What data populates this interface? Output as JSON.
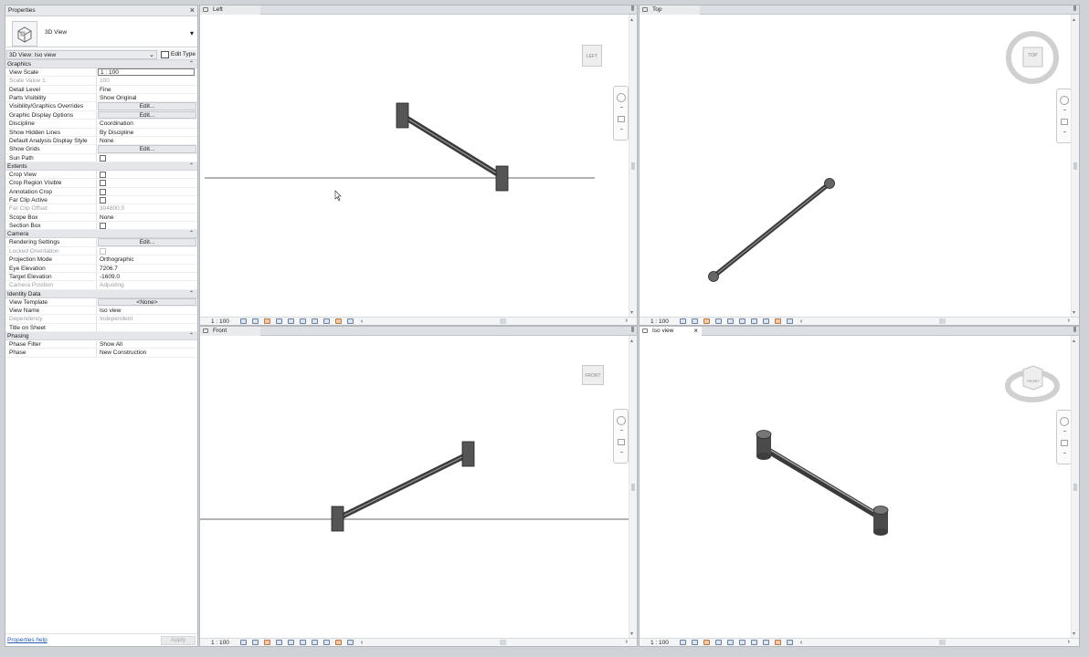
{
  "properties": {
    "title": "Properties",
    "type_name": "3D View",
    "instance_selector": "3D View: Iso view",
    "edit_type": "Edit Type",
    "sections": [
      {
        "name": "Graphics",
        "rows": [
          {
            "k": "View Scale",
            "v": "1 : 100",
            "kind": "select"
          },
          {
            "k": "Scale Value    1:",
            "v": "100",
            "dim": true
          },
          {
            "k": "Detail Level",
            "v": "Fine"
          },
          {
            "k": "Parts Visibility",
            "v": "Show Original"
          },
          {
            "k": "Visibility/Graphics Overrides",
            "v": "Edit...",
            "kind": "button"
          },
          {
            "k": "Graphic Display Options",
            "v": "Edit...",
            "kind": "button"
          },
          {
            "k": "Discipline",
            "v": "Coordination"
          },
          {
            "k": "Show Hidden Lines",
            "v": "By Discipline"
          },
          {
            "k": "Default Analysis Display Style",
            "v": "None"
          },
          {
            "k": "Show Grids",
            "v": "Edit...",
            "kind": "button"
          },
          {
            "k": "Sun Path",
            "v": "",
            "kind": "check"
          }
        ]
      },
      {
        "name": "Extents",
        "rows": [
          {
            "k": "Crop View",
            "v": "",
            "kind": "check"
          },
          {
            "k": "Crop Region Visible",
            "v": "",
            "kind": "check"
          },
          {
            "k": "Annotation Crop",
            "v": "",
            "kind": "check"
          },
          {
            "k": "Far Clip Active",
            "v": "",
            "kind": "check"
          },
          {
            "k": "Far Clip Offset",
            "v": "304800.0",
            "dim": true
          },
          {
            "k": "Scope Box",
            "v": "None"
          },
          {
            "k": "Section Box",
            "v": "",
            "kind": "check"
          }
        ]
      },
      {
        "name": "Camera",
        "rows": [
          {
            "k": "Rendering Settings",
            "v": "Edit...",
            "kind": "button"
          },
          {
            "k": "Locked Orientation",
            "v": "",
            "kind": "check",
            "dim": true
          },
          {
            "k": "Projection Mode",
            "v": "Orthographic"
          },
          {
            "k": "Eye Elevation",
            "v": "7206.7"
          },
          {
            "k": "Target Elevation",
            "v": "-1609.0"
          },
          {
            "k": "Camera Position",
            "v": "Adjusting",
            "dim": true
          }
        ]
      },
      {
        "name": "Identity Data",
        "rows": [
          {
            "k": "View Template",
            "v": "<None>",
            "kind": "button"
          },
          {
            "k": "View Name",
            "v": "Iso view"
          },
          {
            "k": "Dependency",
            "v": "Independent",
            "dim": true
          },
          {
            "k": "Title on Sheet",
            "v": ""
          }
        ]
      },
      {
        "name": "Phasing",
        "rows": [
          {
            "k": "Phase Filter",
            "v": "Show All"
          },
          {
            "k": "Phase",
            "v": "New Construction"
          }
        ]
      }
    ],
    "help_link": "Properties help",
    "apply": "Apply"
  },
  "viewports": [
    {
      "id": "left",
      "tab": "Left",
      "scale": "1 : 100",
      "cube": "LEFT"
    },
    {
      "id": "top",
      "tab": "Top",
      "scale": "1 : 100",
      "cube": "TOP"
    },
    {
      "id": "front",
      "tab": "Front",
      "scale": "1 : 100",
      "cube": "FRONT"
    },
    {
      "id": "iso",
      "tab": "Iso view",
      "scale": "1 : 100",
      "cube": "FRONT"
    }
  ],
  "colors": {
    "accent": "#2a5db0",
    "beam": "#555555",
    "background": "#cfd3d8"
  }
}
